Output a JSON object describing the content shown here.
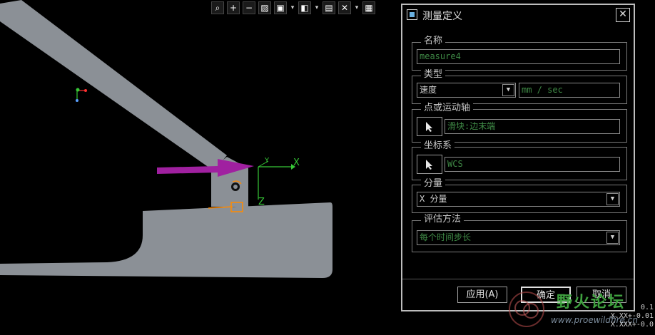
{
  "toolbar": {
    "icons": [
      "zoom-fit-icon",
      "zoom-in-icon",
      "zoom-out-icon",
      "repaint-icon",
      "display-style-icon",
      "view-orientation-icon",
      "saved-views-icon",
      "layers-icon",
      "datum-display-icon",
      "spin-center-icon"
    ]
  },
  "canvas": {
    "axis_x": "X",
    "axis_y": "Y",
    "axis_z": "Z",
    "colors": {
      "part": "#8b9096",
      "arrow": "#a020a0",
      "axis": "#37c837",
      "highlight": "#ff8a00"
    }
  },
  "dialog": {
    "title": "测量定义",
    "close": "✕",
    "name_group": {
      "label": "名称",
      "value": "measure4"
    },
    "type_group": {
      "label": "类型",
      "selected": "速度",
      "units": "mm / sec"
    },
    "point_group": {
      "label": "点或运动轴",
      "value": "滑块:边末端"
    },
    "csys_group": {
      "label": "坐标系",
      "value": "WCS"
    },
    "component_group": {
      "label": "分量",
      "selected": "X 分量"
    },
    "eval_group": {
      "label": "评估方法",
      "selected": "每个时间步长"
    },
    "buttons": {
      "apply": "应用(A)",
      "ok": "确定",
      "cancel": "取消"
    }
  },
  "watermark": {
    "main": "野火论坛",
    "url": "www.proewildfire.cn"
  },
  "coord_readout": [
    "0.1",
    "X.XX+-0.01",
    "X.XXX+-0.0"
  ]
}
